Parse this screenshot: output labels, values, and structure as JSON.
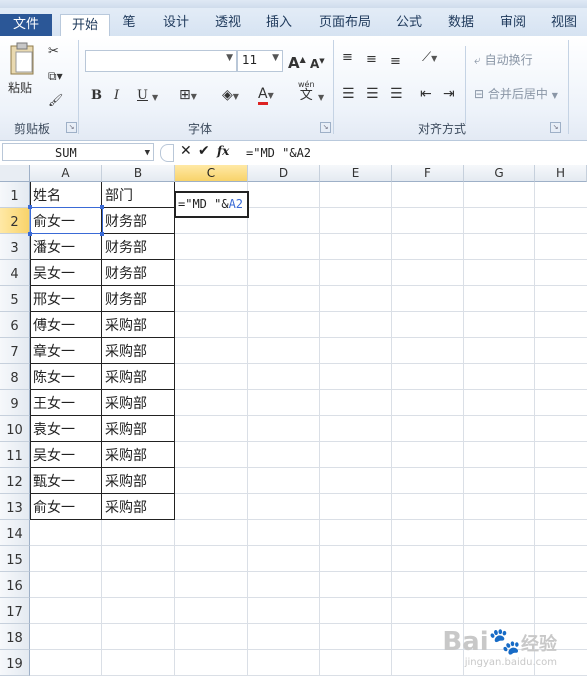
{
  "ribbon_tabs": [
    {
      "label": "文件"
    },
    {
      "label": "开始"
    },
    {
      "label": "笔"
    },
    {
      "label": "设计"
    },
    {
      "label": "透视"
    },
    {
      "label": "插入"
    },
    {
      "label": "页面布局"
    },
    {
      "label": "公式"
    },
    {
      "label": "数据"
    },
    {
      "label": "审阅"
    },
    {
      "label": "视图"
    }
  ],
  "clipboard": {
    "paste_label": "粘贴",
    "group_label": "剪贴板"
  },
  "font": {
    "size_value": "11",
    "bold": "B",
    "italic": "I",
    "underline": "U",
    "group_label": "字体",
    "grow": "A",
    "shrink": "A",
    "color_a": "A",
    "wen": "wén",
    "wen_char": "文"
  },
  "alignment": {
    "wrap_text": "自动换行",
    "merge_center": "合并后居中",
    "group_label": "对齐方式"
  },
  "formula_bar": {
    "name_box": "SUM",
    "fx": "fx",
    "formula": "=\"MD \"&A2"
  },
  "columns": [
    "A",
    "B",
    "C",
    "D",
    "E",
    "F",
    "G",
    "H"
  ],
  "rows": [
    "1",
    "2",
    "3",
    "4",
    "5",
    "6",
    "7",
    "8",
    "9",
    "10",
    "11",
    "12",
    "13",
    "14",
    "15",
    "16",
    "17",
    "18",
    "19"
  ],
  "cells": {
    "header_name": "姓名",
    "header_dept": "部门",
    "data": [
      {
        "name": "俞女一",
        "dept": "财务部"
      },
      {
        "name": "潘女一",
        "dept": "财务部"
      },
      {
        "name": "吴女一",
        "dept": "财务部"
      },
      {
        "name": "邢女一",
        "dept": "财务部"
      },
      {
        "name": "傅女一",
        "dept": "采购部"
      },
      {
        "name": "章女一",
        "dept": "采购部"
      },
      {
        "name": "陈女一",
        "dept": "采购部"
      },
      {
        "name": "王女一",
        "dept": "采购部"
      },
      {
        "name": "袁女一",
        "dept": "采购部"
      },
      {
        "name": "吴女一",
        "dept": "采购部"
      },
      {
        "name": "甄女一",
        "dept": "采购部"
      },
      {
        "name": "俞女一",
        "dept": "采购部"
      }
    ]
  },
  "editing_cell": {
    "prefix": "=\"MD \"&",
    "ref": "A2"
  },
  "watermark": {
    "brand": "Bai",
    "brand_suffix": "经验",
    "url": "jingyan.baidu.com"
  },
  "colors": {
    "accent": "#2b5797",
    "selection": "#f8d36a",
    "ref": "#3a6ad6"
  }
}
